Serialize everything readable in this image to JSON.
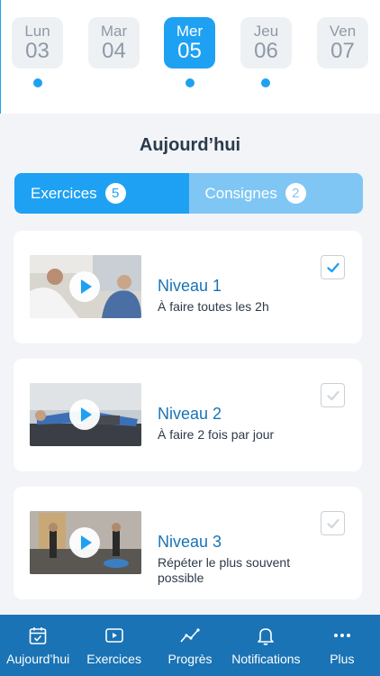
{
  "days": [
    {
      "name": "Lun",
      "num": "03",
      "dot": true
    },
    {
      "name": "Mar",
      "num": "04",
      "dot": false
    },
    {
      "name": "Mer",
      "num": "05",
      "dot": true,
      "active": true
    },
    {
      "name": "Jeu",
      "num": "06",
      "dot": true
    },
    {
      "name": "Ven",
      "num": "07",
      "dot": false
    }
  ],
  "section_title": "Aujourd’hui",
  "tabs": {
    "exercises": {
      "label": "Exercices",
      "count": "5"
    },
    "instructions": {
      "label": "Consignes",
      "count": "2"
    }
  },
  "exercises": [
    {
      "title": "Niveau 1",
      "subtitle": "À faire toutes les 2h",
      "checked": true
    },
    {
      "title": "Niveau 2",
      "subtitle": "À faire 2 fois par jour",
      "checked": false
    },
    {
      "title": "Niveau 3",
      "subtitle": "Répéter le plus souvent possible",
      "checked": false
    }
  ],
  "nav": [
    {
      "label": "Aujourd’hui",
      "icon": "calendar-check-icon"
    },
    {
      "label": "Exercices",
      "icon": "video-play-icon"
    },
    {
      "label": "Progrès",
      "icon": "trend-line-icon"
    },
    {
      "label": "Notifications",
      "icon": "bell-icon"
    },
    {
      "label": "Plus",
      "icon": "more-dots-icon"
    }
  ],
  "colors": {
    "accent": "#1ea1f2",
    "accent_light": "#7fc6f4",
    "navbar": "#1a73b5",
    "title_blue": "#1a73b5"
  }
}
